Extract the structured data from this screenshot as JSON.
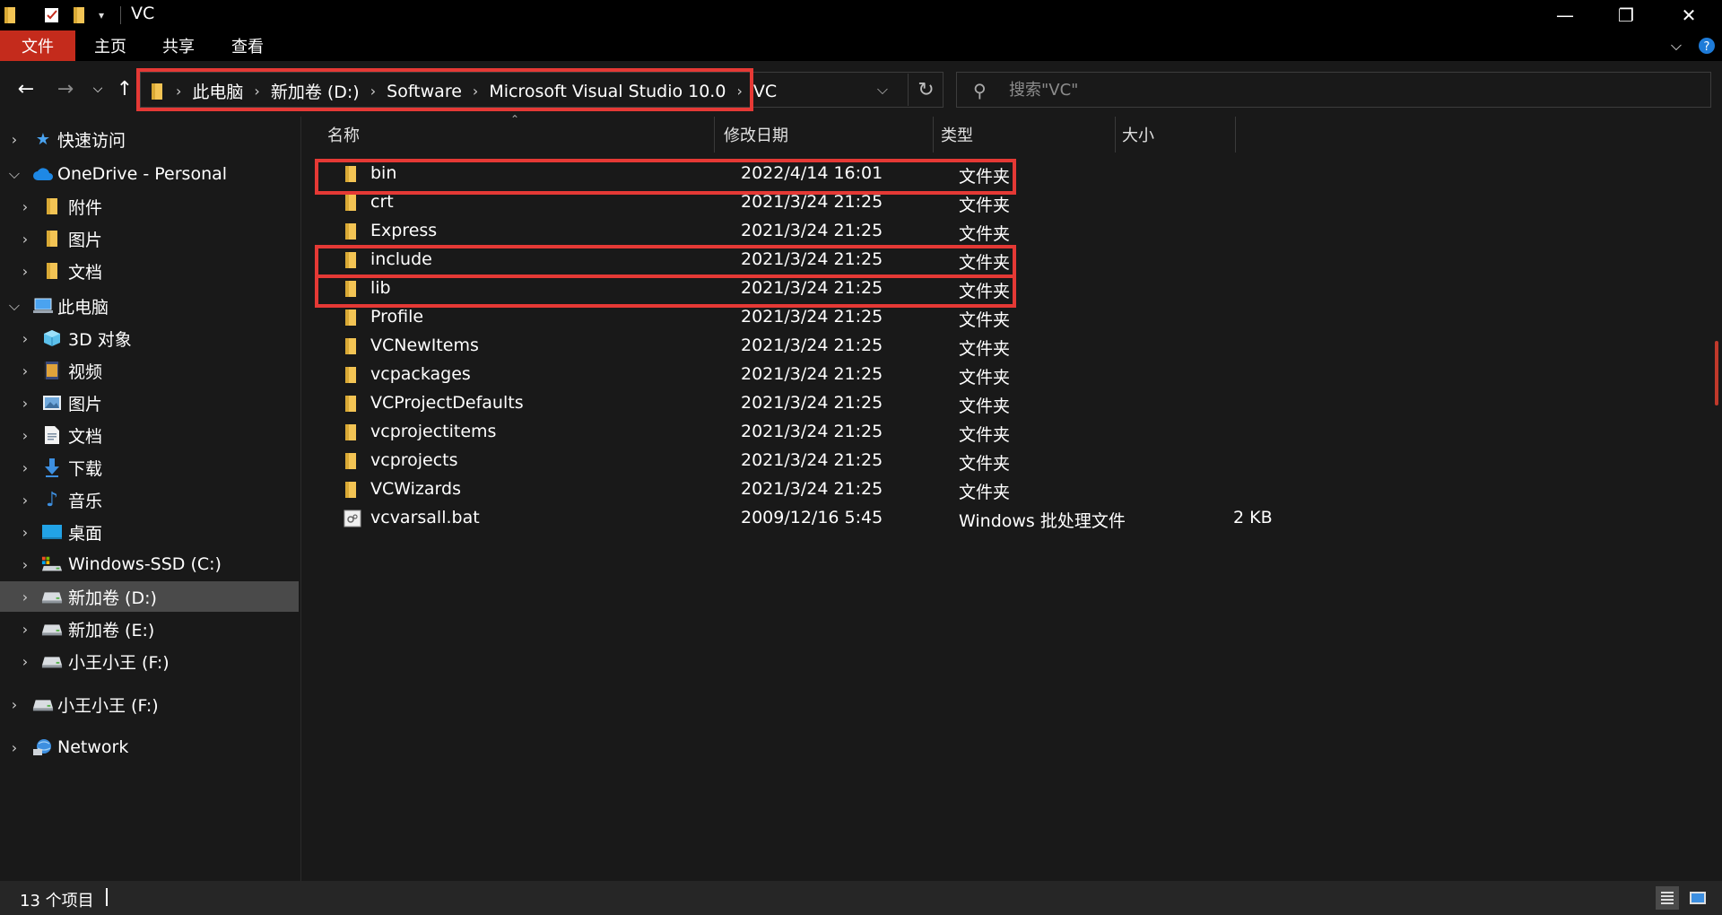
{
  "window": {
    "title": "VC",
    "min_glyph": "—",
    "max_glyph": "❐",
    "close_glyph": "✕"
  },
  "ribbon": {
    "tabs": [
      "文件",
      "主页",
      "共享",
      "查看"
    ]
  },
  "address": {
    "segments": [
      "此电脑",
      "新加卷 (D:)",
      "Software",
      "Microsoft Visual Studio 10.0",
      "VC"
    ]
  },
  "search": {
    "placeholder": "搜索\"VC\""
  },
  "sidebar": {
    "items": [
      {
        "label": "快速访问",
        "icon": "star-icon"
      },
      {
        "label": "OneDrive - Personal",
        "icon": "cloud-icon"
      },
      {
        "label": "附件",
        "icon": "folder-icon"
      },
      {
        "label": "图片",
        "icon": "folder-icon"
      },
      {
        "label": "文档",
        "icon": "folder-icon"
      },
      {
        "label": "此电脑",
        "icon": "computer-icon"
      },
      {
        "label": "3D 对象",
        "icon": "cube-icon"
      },
      {
        "label": "视频",
        "icon": "video-icon"
      },
      {
        "label": "图片",
        "icon": "pictures-icon"
      },
      {
        "label": "文档",
        "icon": "documents-icon"
      },
      {
        "label": "下载",
        "icon": "download-icon"
      },
      {
        "label": "音乐",
        "icon": "music-icon"
      },
      {
        "label": "桌面",
        "icon": "desktop-icon"
      },
      {
        "label": "Windows-SSD (C:)",
        "icon": "drive-icon"
      },
      {
        "label": "新加卷 (D:)",
        "icon": "drive-icon"
      },
      {
        "label": "新加卷 (E:)",
        "icon": "drive-icon"
      },
      {
        "label": "小王小王 (F:)",
        "icon": "drive-icon"
      },
      {
        "label": "小王小王 (F:)",
        "icon": "drive-icon"
      },
      {
        "label": "Network",
        "icon": "network-icon"
      }
    ]
  },
  "columns": {
    "name": "名称",
    "modified": "修改日期",
    "type": "类型",
    "size": "大小"
  },
  "files": [
    {
      "name": "bin",
      "modified": "2022/4/14 16:01",
      "type": "文件夹",
      "size": "",
      "kind": "folder"
    },
    {
      "name": "crt",
      "modified": "2021/3/24 21:25",
      "type": "文件夹",
      "size": "",
      "kind": "folder"
    },
    {
      "name": "Express",
      "modified": "2021/3/24 21:25",
      "type": "文件夹",
      "size": "",
      "kind": "folder"
    },
    {
      "name": "include",
      "modified": "2021/3/24 21:25",
      "type": "文件夹",
      "size": "",
      "kind": "folder"
    },
    {
      "name": "lib",
      "modified": "2021/3/24 21:25",
      "type": "文件夹",
      "size": "",
      "kind": "folder"
    },
    {
      "name": "Profile",
      "modified": "2021/3/24 21:25",
      "type": "文件夹",
      "size": "",
      "kind": "folder"
    },
    {
      "name": "VCNewItems",
      "modified": "2021/3/24 21:25",
      "type": "文件夹",
      "size": "",
      "kind": "folder"
    },
    {
      "name": "vcpackages",
      "modified": "2021/3/24 21:25",
      "type": "文件夹",
      "size": "",
      "kind": "folder"
    },
    {
      "name": "VCProjectDefaults",
      "modified": "2021/3/24 21:25",
      "type": "文件夹",
      "size": "",
      "kind": "folder"
    },
    {
      "name": "vcprojectitems",
      "modified": "2021/3/24 21:25",
      "type": "文件夹",
      "size": "",
      "kind": "folder"
    },
    {
      "name": "vcprojects",
      "modified": "2021/3/24 21:25",
      "type": "文件夹",
      "size": "",
      "kind": "folder"
    },
    {
      "name": "VCWizards",
      "modified": "2021/3/24 21:25",
      "type": "文件夹",
      "size": "",
      "kind": "folder"
    },
    {
      "name": "vcvarsall.bat",
      "modified": "2009/12/16 5:45",
      "type": "Windows 批处理文件",
      "size": "2 KB",
      "kind": "batch"
    }
  ],
  "status": {
    "count": "13 个项目"
  },
  "colors": {
    "highlight": "#e53935",
    "folder": "#f3c454",
    "file_tab": "#c42b1c"
  }
}
